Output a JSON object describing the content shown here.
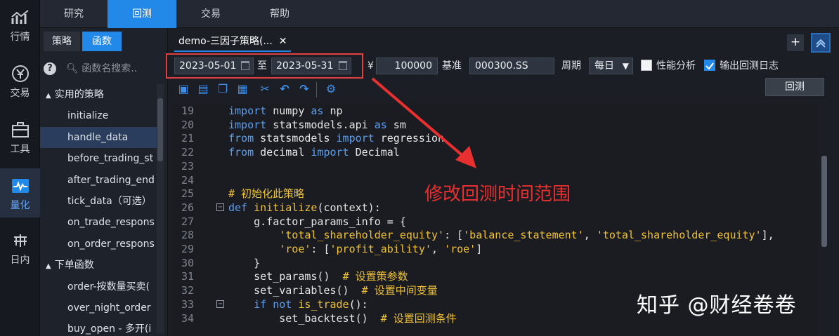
{
  "rail": [
    {
      "label": "行情",
      "icon": "chart-icon"
    },
    {
      "label": "交易",
      "icon": "yen-icon"
    },
    {
      "label": "工具",
      "icon": "toolbox-icon"
    },
    {
      "label": "量化",
      "icon": "pulse-icon"
    },
    {
      "label": "日内",
      "icon": "intraday-icon"
    }
  ],
  "topnav": [
    "研究",
    "回测",
    "交易",
    "帮助"
  ],
  "left_tabs": [
    "策略",
    "函数"
  ],
  "search": {
    "placeholder": "函数名搜索.."
  },
  "tree": [
    {
      "type": "group",
      "label": "实用的策略"
    },
    {
      "type": "leaf",
      "label": "initialize"
    },
    {
      "type": "leaf",
      "label": "handle_data"
    },
    {
      "type": "leaf",
      "label": "before_trading_st"
    },
    {
      "type": "leaf",
      "label": "after_trading_end"
    },
    {
      "type": "leaf",
      "label": "tick_data（可选）"
    },
    {
      "type": "leaf",
      "label": "on_trade_respons"
    },
    {
      "type": "leaf",
      "label": "on_order_respons"
    },
    {
      "type": "group",
      "label": "下单函数"
    },
    {
      "type": "leaf",
      "label": "order-按数量买卖("
    },
    {
      "type": "leaf",
      "label": "over_night_order"
    },
    {
      "type": "leaf",
      "label": "buy_open - 多开(i"
    }
  ],
  "doc_tab": {
    "title": "demo-三因子策略(...",
    "close": "✕"
  },
  "buttons": {
    "plus": "+",
    "run": "回测"
  },
  "params": {
    "start_date": "2023-05-01",
    "to": "至",
    "end_date": "2023-05-31",
    "currency": "¥",
    "capital": "100000",
    "benchmark_label": "基准",
    "benchmark": "000300.SS",
    "period_label": "周期",
    "period": "每日",
    "perf_label": "性能分析",
    "log_label": "输出回测日志"
  },
  "code_lines": [
    {
      "n": "19",
      "html": "<span class='kw'>import</span> numpy <span class='kw'>as</span> np"
    },
    {
      "n": "20",
      "html": "<span class='kw'>import</span> statsmodels.api <span class='kw'>as</span> sm"
    },
    {
      "n": "21",
      "html": "<span class='kw'>from</span> statsmodels <span class='kw'>import</span> regression"
    },
    {
      "n": "22",
      "html": "<span class='kw'>from</span> decimal <span class='kw'>import</span> Decimal"
    },
    {
      "n": "23",
      "html": ""
    },
    {
      "n": "24",
      "html": ""
    },
    {
      "n": "25",
      "html": "<span class='cm'># 初始化此策略</span>"
    },
    {
      "n": "26",
      "fold": "⊟",
      "html": "<span class='kw'>def</span> <span class='fn'>initialize</span>(context):"
    },
    {
      "n": "27",
      "html": "    g.factor_params_info = {"
    },
    {
      "n": "28",
      "html": "        <span class='st'>'total_shareholder_equity'</span>: [<span class='st'>'balance_statement'</span>, <span class='st'>'total_shareholder_equity'</span>],"
    },
    {
      "n": "29",
      "html": "        <span class='st'>'roe'</span>: [<span class='st'>'profit_ability'</span>, <span class='st'>'roe'</span>]"
    },
    {
      "n": "30",
      "html": "    }"
    },
    {
      "n": "31",
      "html": "    set_params()  <span class='cm'># 设置策参数</span>"
    },
    {
      "n": "32",
      "html": "    set_variables()  <span class='cm'># 设置中间变量</span>"
    },
    {
      "n": "33",
      "fold": "⊟",
      "html": "    <span class='kw'>if not</span> <span class='fn'>is_trade</span>():"
    },
    {
      "n": "34",
      "html": "        set_backtest()  <span class='cm'># 设置回测条件</span>"
    }
  ],
  "annotation": "修改回测时间范围",
  "watermark": "知乎 @财经卷卷"
}
